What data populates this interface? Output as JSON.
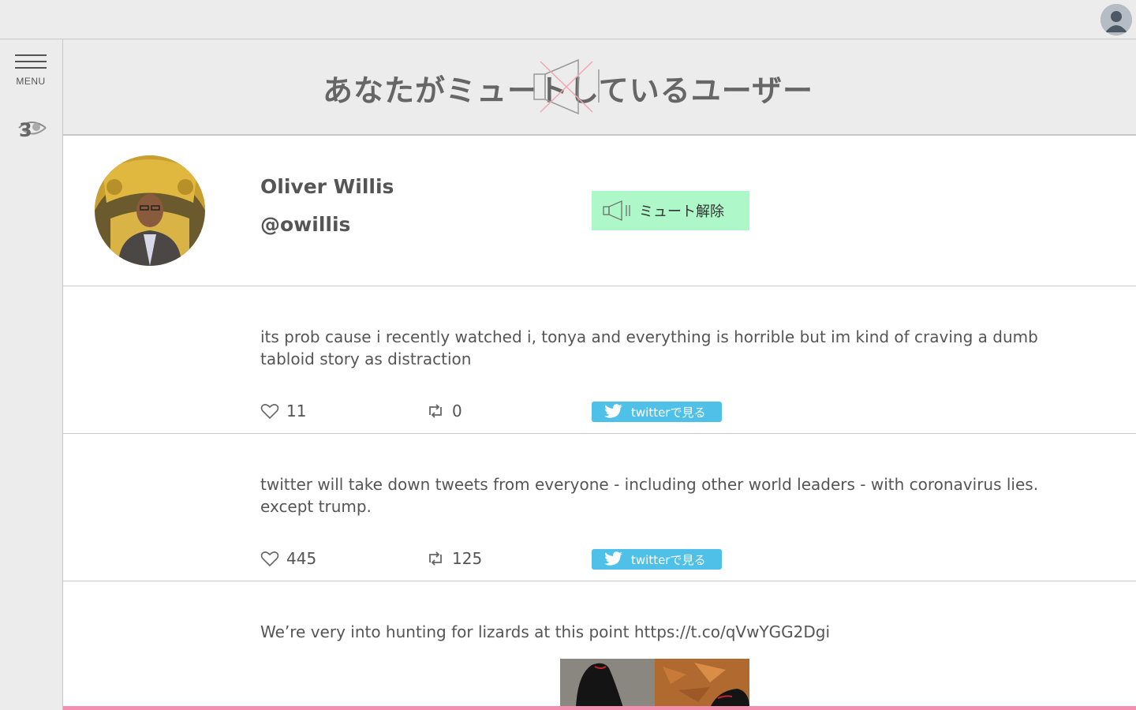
{
  "top_bar": {
    "avatar_icon": "user-avatar-icon"
  },
  "sidebar": {
    "menu_label": "MENU",
    "logo_icon": "eye-three-icon"
  },
  "header": {
    "title": "あなたがミュートしているユーザー",
    "title_mark_icon": "muted-speaker-mark"
  },
  "profile": {
    "name": "Oliver Willis",
    "handle": "@owillis",
    "unmute_label": "ミュート解除",
    "unmute_color": "#aef7c9"
  },
  "tweets": [
    {
      "text": "its prob cause i recently watched i, tonya and everything is horrible but im kind of craving a dumb tabloid story as distraction",
      "likes": "11",
      "retweets": "0",
      "view_label": "twitterで見る"
    },
    {
      "text": "twitter will take down tweets from everyone - including other world leaders - with coronavirus lies. except trump.",
      "likes": "445",
      "retweets": "125",
      "view_label": "twitterで見る"
    },
    {
      "text": "We’re very into hunting for lizards at this point https://t.co/qVwYGG2Dgi"
    }
  ],
  "colors": {
    "twitter_button": "#4fc1e9",
    "bottom_accent": "#f48fb1"
  }
}
